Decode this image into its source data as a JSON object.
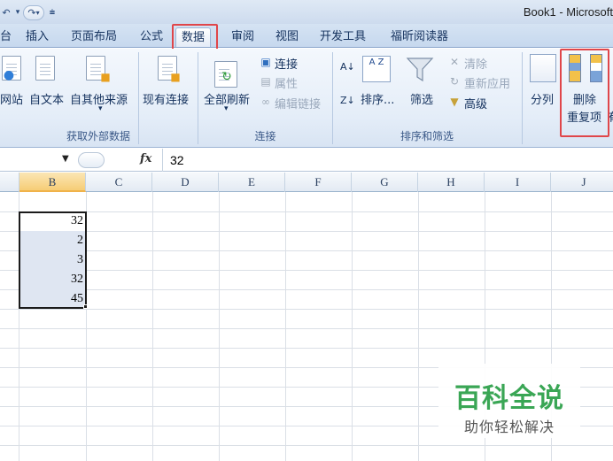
{
  "window": {
    "title": "Book1 - Microsoft"
  },
  "quick_access": {
    "undo_icon": "undo-icon",
    "redo_icon": "redo-icon",
    "customize_icon": "customize-qat-icon",
    "undo_glyph": "↶",
    "redo_glyph": "↷",
    "more_glyph": "▾",
    "customize_glyph": "⩧"
  },
  "tabs": [
    {
      "label": "台"
    },
    {
      "label": "插入"
    },
    {
      "label": "页面布局"
    },
    {
      "label": "公式"
    },
    {
      "label": "数据",
      "active": true
    },
    {
      "label": "审阅"
    },
    {
      "label": "视图"
    },
    {
      "label": "开发工具"
    },
    {
      "label": "福昕阅读器"
    }
  ],
  "ribbon": {
    "groups": {
      "external_data": {
        "label": "获取外部数据",
        "buttons": {
          "web": "网站",
          "text": "自文本",
          "other": "自其他来源",
          "existing": "现有连接",
          "other_arrow": "▾"
        }
      },
      "connections": {
        "label": "连接",
        "buttons": {
          "refresh_all": "全部刷新",
          "refresh_arrow": "▾",
          "connections": "连接",
          "properties": "属性",
          "edit_links": "编辑链接"
        }
      },
      "sort_filter": {
        "label": "排序和筛选",
        "buttons": {
          "sort_asc_label": "A↓",
          "sort_desc_label": "Z↓",
          "sort": "排序...",
          "filter": "筛选",
          "clear": "清除",
          "reapply": "重新应用",
          "advanced": "高级"
        }
      },
      "data_tools": {
        "buttons": {
          "text_to_columns": "分列",
          "remove_dup_line1": "删除",
          "remove_dup_line2": "重复项",
          "cut_off": "有"
        }
      }
    },
    "icons": {
      "sort_az": "A Z",
      "sort_za": "Z A"
    }
  },
  "formula_bar": {
    "fx_label": "fx",
    "value": "32"
  },
  "sheet": {
    "columns": [
      "B",
      "C",
      "D",
      "E",
      "F",
      "G",
      "H",
      "I",
      "J"
    ],
    "selected_column": "B",
    "values": [
      "32",
      "2",
      "3",
      "32",
      "45"
    ]
  },
  "watermark": {
    "title": "百科全说",
    "subtitle": "助你轻松解决"
  },
  "colors": {
    "highlight_red": "#e0464a",
    "watermark_green": "#3aa655",
    "selection_fill": "#dfe6f2"
  }
}
